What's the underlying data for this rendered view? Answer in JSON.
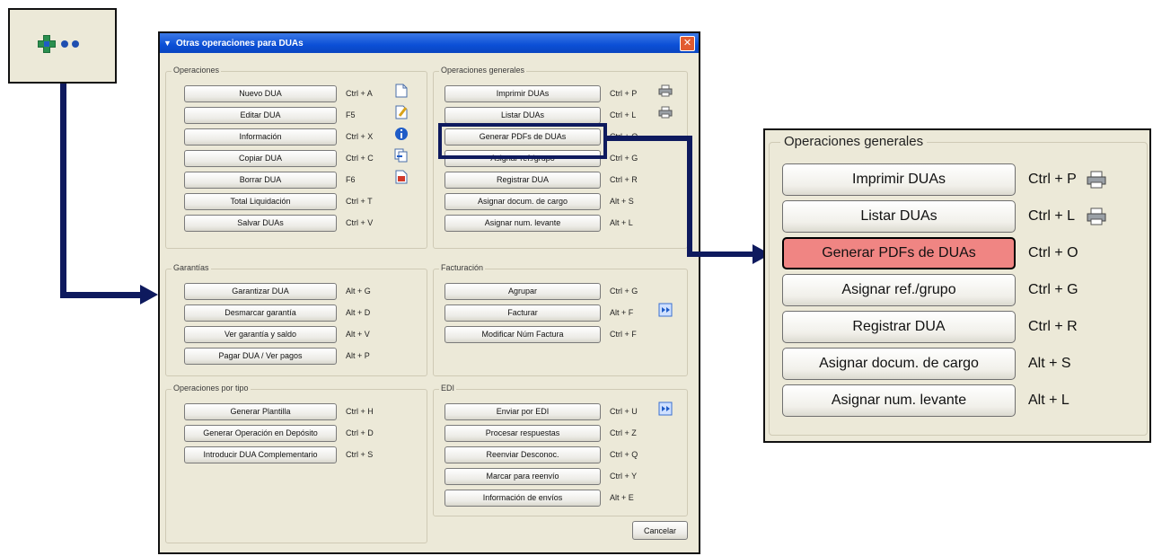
{
  "toolbar": {
    "button_icon": "add-dots-icon"
  },
  "dialog": {
    "title": "Otras operaciones para DUAs",
    "cancel_label": "Cancelar",
    "groups": {
      "operaciones": {
        "legend": "Operaciones",
        "items": [
          {
            "label": "Nuevo DUA",
            "shortcut": "Ctrl + A",
            "icon": "new-document-icon"
          },
          {
            "label": "Editar DUA",
            "shortcut": "F5",
            "icon": "edit-document-icon"
          },
          {
            "label": "Información",
            "shortcut": "Ctrl + X",
            "icon": "info-icon"
          },
          {
            "label": "Copiar DUA",
            "shortcut": "Ctrl + C",
            "icon": "copy-icon"
          },
          {
            "label": "Borrar DUA",
            "shortcut": "F6",
            "icon": "delete-icon"
          },
          {
            "label": "Total Liquidación",
            "shortcut": "Ctrl + T"
          },
          {
            "label": "Salvar DUAs",
            "shortcut": "Ctrl + V"
          }
        ]
      },
      "operaciones_generales": {
        "legend": "Operaciones generales",
        "items": [
          {
            "label": "Imprimir DUAs",
            "shortcut": "Ctrl + P",
            "icon": "printer-icon"
          },
          {
            "label": "Listar DUAs",
            "shortcut": "Ctrl + L",
            "icon": "printer-icon"
          },
          {
            "label": "Generar PDFs de DUAs",
            "shortcut": "Ctrl + O"
          },
          {
            "label": "Asignar ref./grupo",
            "shortcut": "Ctrl + G"
          },
          {
            "label": "Registrar DUA",
            "shortcut": "Ctrl + R"
          },
          {
            "label": "Asignar docum. de cargo",
            "shortcut": "Alt + S"
          },
          {
            "label": "Asignar num. levante",
            "shortcut": "Alt + L"
          }
        ]
      },
      "garantias": {
        "legend": "Garantías",
        "items": [
          {
            "label": "Garantizar DUA",
            "shortcut": "Alt + G"
          },
          {
            "label": "Desmarcar garantía",
            "shortcut": "Alt + D"
          },
          {
            "label": "Ver garantía y saldo",
            "shortcut": "Alt + V"
          },
          {
            "label": "Pagar DUA / Ver pagos",
            "shortcut": "Alt + P"
          }
        ]
      },
      "facturacion": {
        "legend": "Facturación",
        "items": [
          {
            "label": "Agrupar",
            "shortcut": "Ctrl + G"
          },
          {
            "label": "Facturar",
            "shortcut": "Alt + F",
            "icon": "invoice-icon"
          },
          {
            "label": "Modificar Núm Factura",
            "shortcut": "Ctrl + F"
          }
        ]
      },
      "operaciones_por_tipo": {
        "legend": "Operaciones por tipo",
        "items": [
          {
            "label": "Generar Plantilla",
            "shortcut": "Ctrl + H"
          },
          {
            "label": "Generar Operación en Depósito",
            "shortcut": "Ctrl + D"
          },
          {
            "label": "Introducir DUA Complementario",
            "shortcut": "Ctrl + S"
          }
        ]
      },
      "edi": {
        "legend": "EDI",
        "items": [
          {
            "label": "Enviar por EDI",
            "shortcut": "Ctrl + U",
            "icon": "send-edi-icon"
          },
          {
            "label": "Procesar respuestas",
            "shortcut": "Ctrl + Z"
          },
          {
            "label": "Reenviar Desconoc.",
            "shortcut": "Ctrl + Q"
          },
          {
            "label": "Marcar para reenvío",
            "shortcut": "Ctrl + Y"
          },
          {
            "label": "Información de envíos",
            "shortcut": "Alt + E"
          }
        ]
      }
    }
  },
  "zoom": {
    "legend": "Operaciones generales",
    "items": [
      {
        "label": "Imprimir DUAs",
        "shortcut": "Ctrl + P",
        "icon": "printer-icon"
      },
      {
        "label": "Listar DUAs",
        "shortcut": "Ctrl + L",
        "icon": "printer-icon"
      },
      {
        "label": "Generar PDFs de DUAs",
        "shortcut": "Ctrl + O",
        "highlighted": true
      },
      {
        "label": "Asignar ref./grupo",
        "shortcut": "Ctrl + G"
      },
      {
        "label": "Registrar DUA",
        "shortcut": "Ctrl + R"
      },
      {
        "label": "Asignar docum. de cargo",
        "shortcut": "Alt + S"
      },
      {
        "label": "Asignar num. levante",
        "shortcut": "Alt + L"
      }
    ]
  },
  "colors": {
    "connector": "#0e1a5e",
    "highlight": "#f08583",
    "dialog_bg": "#ece9d8"
  }
}
